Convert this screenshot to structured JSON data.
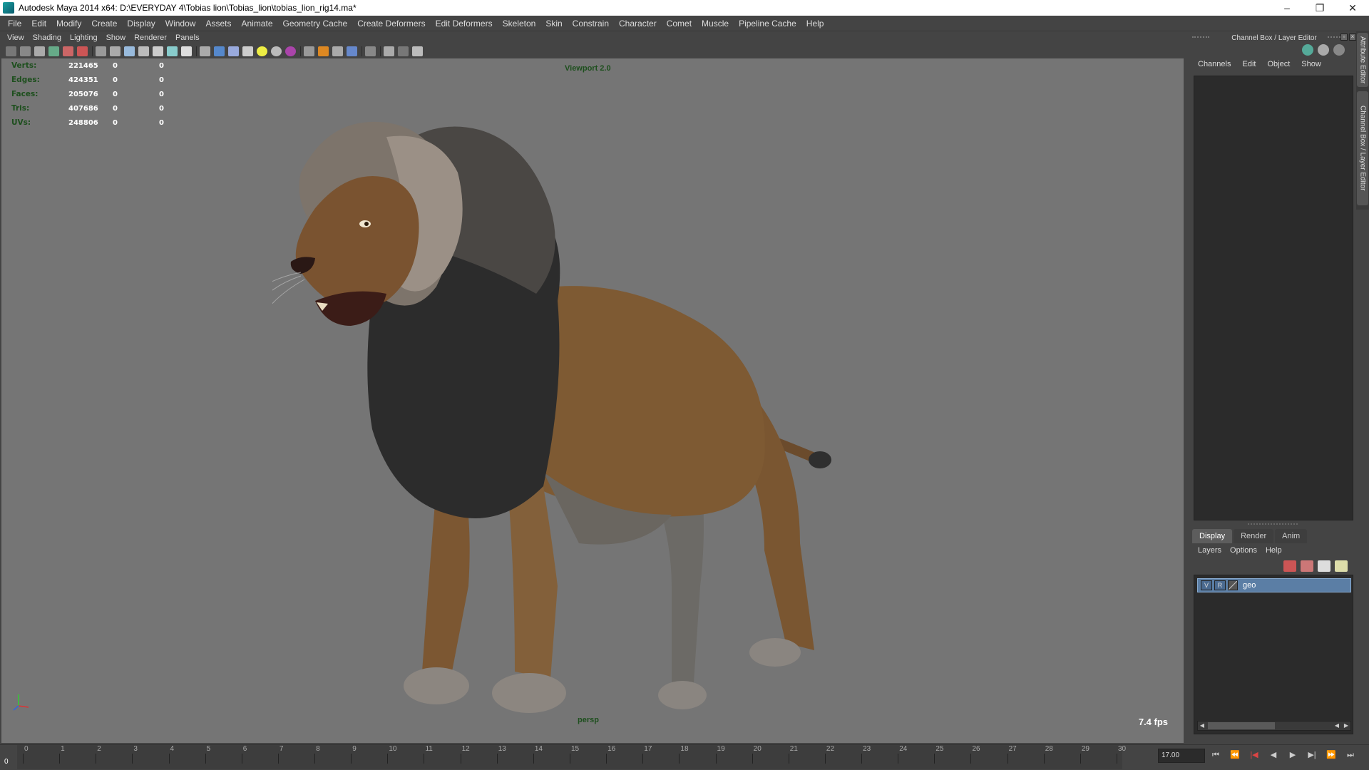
{
  "window": {
    "title": "Autodesk Maya 2014 x64: D:\\EVERYDAY 4\\Tobias lion\\Tobias_lion\\tobias_lion_rig14.ma*",
    "minimize": "–",
    "restore": "❐",
    "close": "✕"
  },
  "menubar": [
    "File",
    "Edit",
    "Modify",
    "Create",
    "Display",
    "Window",
    "Assets",
    "Animate",
    "Geometry Cache",
    "Create Deformers",
    "Edit Deformers",
    "Skeleton",
    "Skin",
    "Constrain",
    "Character",
    "Comet",
    "Muscle",
    "Pipeline Cache",
    "Help"
  ],
  "panel_menu": [
    "View",
    "Shading",
    "Lighting",
    "Show",
    "Renderer",
    "Panels"
  ],
  "hud": [
    {
      "label": "Verts:",
      "value": "221465",
      "sel": "0",
      "comp": "0"
    },
    {
      "label": "Edges:",
      "value": "424351",
      "sel": "0",
      "comp": "0"
    },
    {
      "label": "Faces:",
      "value": "205076",
      "sel": "0",
      "comp": "0"
    },
    {
      "label": "Tris:",
      "value": "407686",
      "sel": "0",
      "comp": "0"
    },
    {
      "label": "UVs:",
      "value": "248806",
      "sel": "0",
      "comp": "0"
    }
  ],
  "viewport": {
    "renderer_label": "Viewport 2.0",
    "camera": "persp",
    "fps": "7.4 fps",
    "background_color": "#757575",
    "hud_label_color": "#1d4f1d"
  },
  "channel_box": {
    "header": "Channel Box / Layer Editor",
    "menus": [
      "Channels",
      "Edit",
      "Object",
      "Show"
    ]
  },
  "layer_editor": {
    "tabs": [
      "Display",
      "Render",
      "Anim"
    ],
    "active_tab": "Display",
    "menus": [
      "Layers",
      "Options",
      "Help"
    ],
    "layers": [
      {
        "v": "V",
        "r": "R",
        "name": "geo"
      }
    ]
  },
  "side_tabs": [
    "Attribute Editor",
    "Channel Box / Layer Editor"
  ],
  "timeline": {
    "ticks": [
      "0",
      "1",
      "2",
      "3",
      "4",
      "5",
      "6",
      "7",
      "8",
      "9",
      "10",
      "11",
      "12",
      "13",
      "14",
      "15",
      "16",
      "17",
      "18",
      "19",
      "20",
      "21",
      "22",
      "23",
      "24",
      "25",
      "26",
      "27",
      "28",
      "29",
      "30"
    ],
    "current_frame": "0",
    "time_field": "17.00"
  },
  "playback": [
    "go-to-start-icon",
    "step-back-key-icon",
    "step-back-icon",
    "play-back-icon",
    "play-forward-icon",
    "step-forward-key-icon",
    "go-to-end-icon"
  ]
}
